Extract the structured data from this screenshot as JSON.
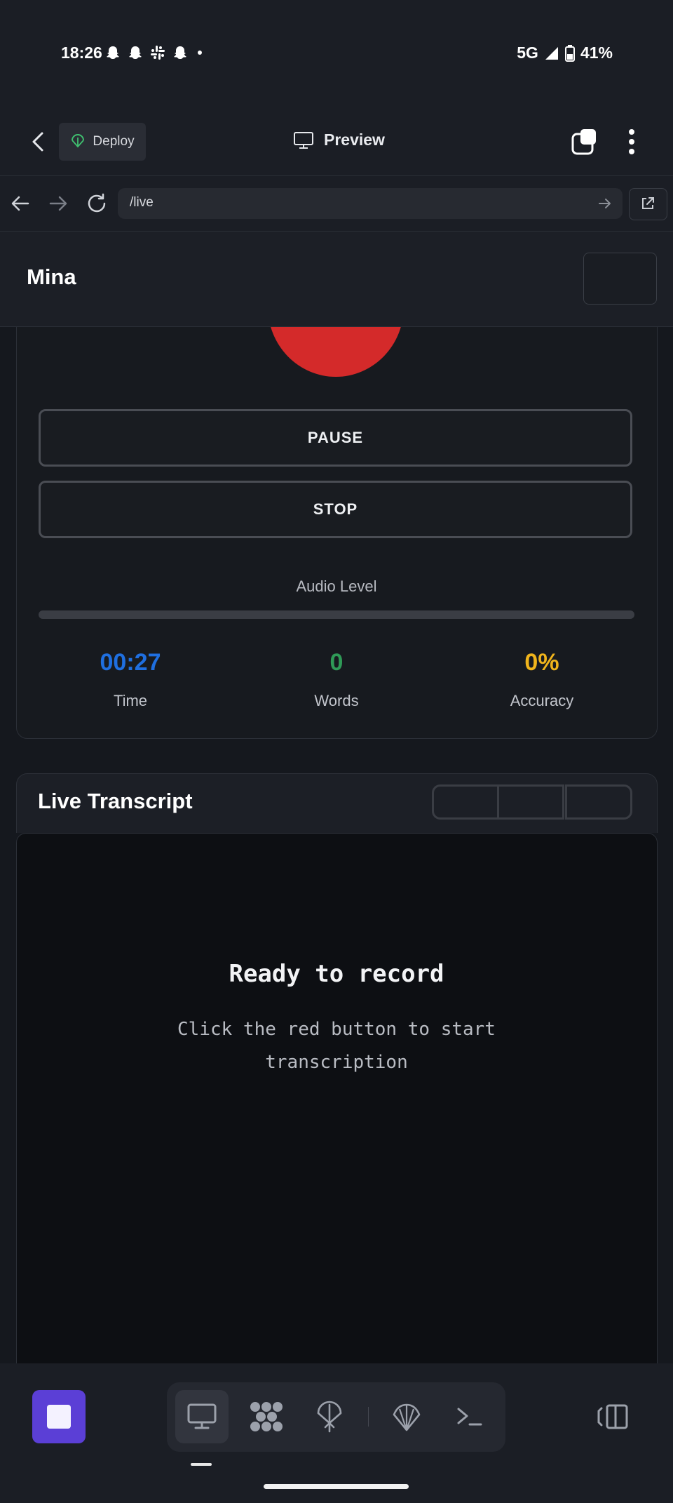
{
  "status_bar": {
    "time": "18:26",
    "notification_icons": [
      "snapchat-icon",
      "snapchat-icon",
      "slack-icon",
      "snapchat-icon",
      "dot-icon"
    ],
    "network": "5G",
    "battery": "41%"
  },
  "header": {
    "deploy_label": "Deploy",
    "preview_label": "Preview"
  },
  "browser": {
    "url": "/live"
  },
  "page": {
    "title": "Mina"
  },
  "recorder": {
    "pause_label": "PAUSE",
    "stop_label": "STOP",
    "audio_level_label": "Audio Level",
    "audio_level": 0,
    "stats": [
      {
        "value": "00:27",
        "label": "Time",
        "color": "#1f6fe0"
      },
      {
        "value": "0",
        "label": "Words",
        "color": "#2f9a57"
      },
      {
        "value": "0%",
        "label": "Accuracy",
        "color": "#f0b41c"
      }
    ],
    "record_button_color": "#d42a2a"
  },
  "transcript": {
    "title": "Live Transcript",
    "empty_title": "Ready to record",
    "empty_subtitle": "Click the red button to start transcription"
  },
  "bottom_nav": {
    "tabs": [
      "monitor-icon",
      "grid-blob-icon",
      "deploy-parachute-icon",
      "shell-icon",
      "terminal-icon"
    ],
    "accent": "#5b3fd6"
  }
}
